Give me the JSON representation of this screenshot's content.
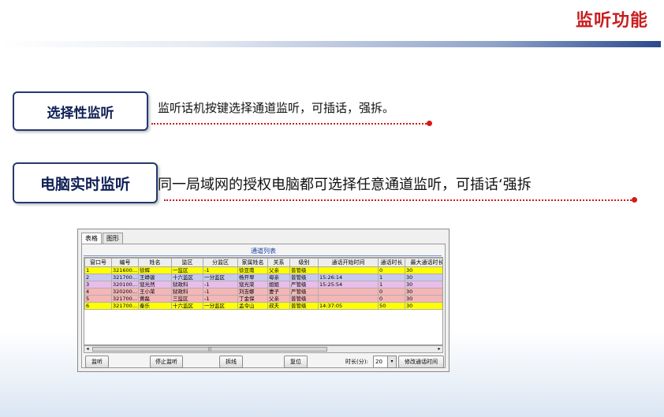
{
  "slide": {
    "title": "监听功能",
    "features": [
      {
        "label": "选择性监听",
        "description": "监听话机按键选择通道监听，可插话，强拆。"
      },
      {
        "label": "电脑实时监听",
        "description": "同一局域网的授权电脑都可选择任意通道监听，可插话‘强拆"
      }
    ]
  },
  "app": {
    "tabs": [
      "表格",
      "图形"
    ],
    "grid_title": "通道列表",
    "columns": [
      "窗口号",
      "编号",
      "姓名",
      "监区",
      "分监区",
      "家属姓名",
      "关系",
      "级别",
      "通话开始时间",
      "通话时长",
      "最大通话时长"
    ],
    "rows": [
      {
        "color": "#ffff00",
        "cells": [
          "1",
          "321600...",
          "徐辉",
          "一监区",
          "-1",
          "徐亚南",
          "父亲",
          "普管级",
          "",
          "0",
          "30"
        ]
      },
      {
        "color": "#c8c8f0",
        "cells": [
          "2",
          "321700...",
          "王峥骏",
          "十六监区",
          "一分监区",
          "杨开翠",
          "母亲",
          "普管级",
          "15:26:14",
          "1",
          "30"
        ]
      },
      {
        "color": "#e8bde8",
        "cells": [
          "3",
          "320100...",
          "寇光然",
          "狱政科",
          "-1",
          "寇光荣",
          "姐姐",
          "严管级",
          "15:25:54",
          "1",
          "30"
        ]
      },
      {
        "color": "#f4b6b6",
        "cells": [
          "4",
          "320200...",
          "王小荣",
          "狱政科",
          "-1",
          "刘吉娜",
          "妻子",
          "严管级",
          "",
          "0",
          "30"
        ]
      },
      {
        "color": "#f4b6b6",
        "cells": [
          "5",
          "321700...",
          "黄磊",
          "三监区",
          "-1",
          "丁金保",
          "父亲",
          "普管级",
          "",
          "0",
          "30"
        ]
      },
      {
        "color": "#ffff00",
        "cells": [
          "6",
          "321700...",
          "秦乐",
          "十六监区",
          "一分监区",
          "孟令山",
          "叔夫",
          "普管级",
          "14:37:05",
          "50",
          "30"
        ]
      }
    ],
    "scroll": {
      "left_arrow": "◂",
      "right_arrow": "▸",
      "thumb_grip": "|||"
    },
    "buttons": {
      "listen": "监听",
      "stop": "停止监听",
      "break": "拆线",
      "reset": "复位",
      "modify": "修改通话时间"
    },
    "duration": {
      "label": "时长(分):",
      "value": "20",
      "arrow": "▾"
    }
  }
}
